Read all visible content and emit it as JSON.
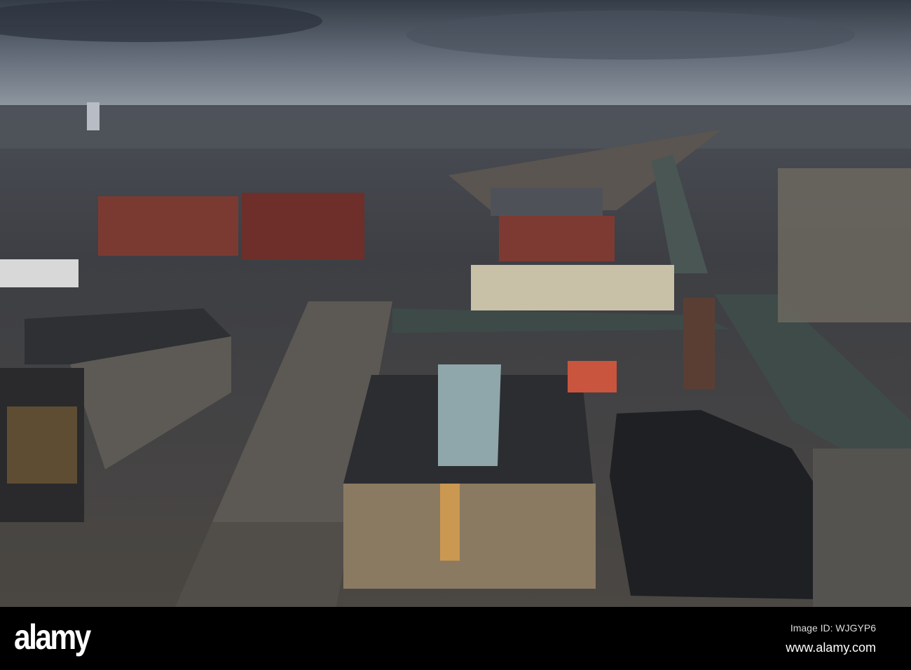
{
  "watermark": {
    "logo": "alamy",
    "image_id": "Image ID: WJGYP6",
    "website": "www.alamy.com"
  },
  "colors": {
    "sky_top": "#3a4350",
    "sky_horizon": "#8a93a0",
    "city": "#3b3d40",
    "river": "#3f4a48",
    "brick": "#7a3a32",
    "bar": "#000000"
  }
}
